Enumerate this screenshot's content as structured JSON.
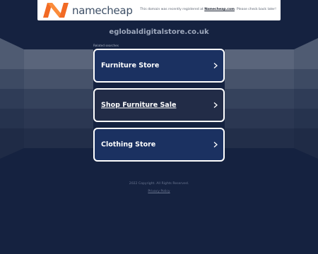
{
  "header": {
    "brand": "namecheap",
    "notice_prefix": "This domain was recently registered at",
    "notice_link": "Namecheap.com",
    "notice_suffix": ". Please check back later!"
  },
  "domain": "eglobaldigitalstore.co.uk",
  "related_label": "Related searches",
  "searches": [
    {
      "label": "Furniture Store"
    },
    {
      "label": "Shop Furniture Sale"
    },
    {
      "label": "Clothing Store"
    }
  ],
  "footer": {
    "copyright": "2022 Copyright. All Rights Reserved.",
    "privacy": "Privacy Policy"
  },
  "colors": {
    "background": "#152240",
    "card": "#1b3161",
    "card_hover": "#222c47",
    "logo_orange": "#f26a24"
  },
  "icons": {
    "logo": "namecheap-n-logo",
    "chevron": "chevron-right-icon"
  }
}
